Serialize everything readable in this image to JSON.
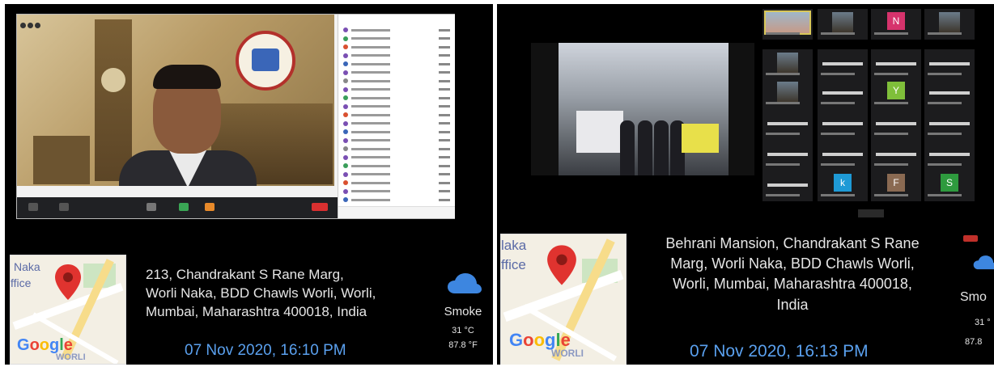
{
  "left": {
    "address_lines": [
      "213, Chandrakant S Rane Marg,",
      "Worli Naka, BDD Chawls Worli, Worli,",
      "Mumbai, Maharashtra 400018, India"
    ],
    "datetime": "07 Nov 2020, 16:10 PM",
    "weather": {
      "condition": "Smoke",
      "temp_c": "31 °C",
      "temp_f": "87.8 °F"
    },
    "map": {
      "place_text_1": "Naka",
      "place_text_2": "ffice",
      "google": "Google",
      "area": "WORLI"
    }
  },
  "right": {
    "address_lines": [
      "Behrani Mansion, Chandrakant S Rane",
      "Marg, Worli Naka, BDD Chawls Worli,",
      "Worli, Mumbai, Maharashtra 400018,",
      "India"
    ],
    "datetime": "07 Nov 2020, 16:13 PM",
    "weather": {
      "condition": "Smo",
      "temp_c": "31 °",
      "temp_f": "87.8"
    },
    "map": {
      "place_text_1": "laka",
      "place_text_2": "ffice",
      "google": "Google",
      "area": "WORLI"
    },
    "gallery_letters": [
      "N",
      "Y",
      "k",
      "F",
      "S"
    ]
  },
  "colors": {
    "address": "#e6e6e6",
    "datetime": "#5aa0ee",
    "pin": "#e0332f",
    "cloud": "#3d86e0"
  },
  "icons": [
    "map-pin-icon",
    "cloud-icon"
  ]
}
